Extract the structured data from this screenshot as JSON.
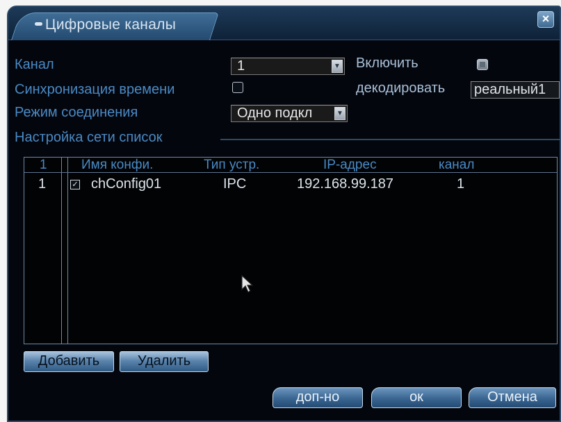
{
  "dialog": {
    "title": "Цифровые каналы",
    "close_label": "×"
  },
  "form": {
    "channel_label": "Канал",
    "channel_value": "1",
    "enable_label": "Включить",
    "enable_checked": true,
    "time_sync_label": "Синхронизация времени",
    "time_sync_checked": false,
    "decode_label": "декодировать",
    "decode_value": "реальный1",
    "connection_mode_label": "Режим соединения",
    "connection_mode_value": "Одно подкл"
  },
  "network_list": {
    "section_title": "Настройка сети список",
    "columns": {
      "index": "1",
      "config_name": "Имя конфи.",
      "device_type": "Тип устр.",
      "ip_address": "IP-адрес",
      "channel": "канал"
    },
    "rows": [
      {
        "index": "1",
        "checked": true,
        "config_name": "chConfig01",
        "device_type": "IPC",
        "ip_address": "192.168.99.187",
        "channel": "1"
      }
    ]
  },
  "buttons": {
    "add": "Добавить",
    "delete": "Удалить",
    "advanced": "доп-но",
    "ok": "ок",
    "cancel": "Отмена"
  },
  "icons": {
    "close": "close-icon",
    "dropdown": "chevron-down-icon",
    "cursor": "mouse-pointer-icon"
  },
  "colors": {
    "label_blue": "#4a8ac4",
    "dialog_background": "#04060e",
    "button_blue": "#5c85ad"
  }
}
